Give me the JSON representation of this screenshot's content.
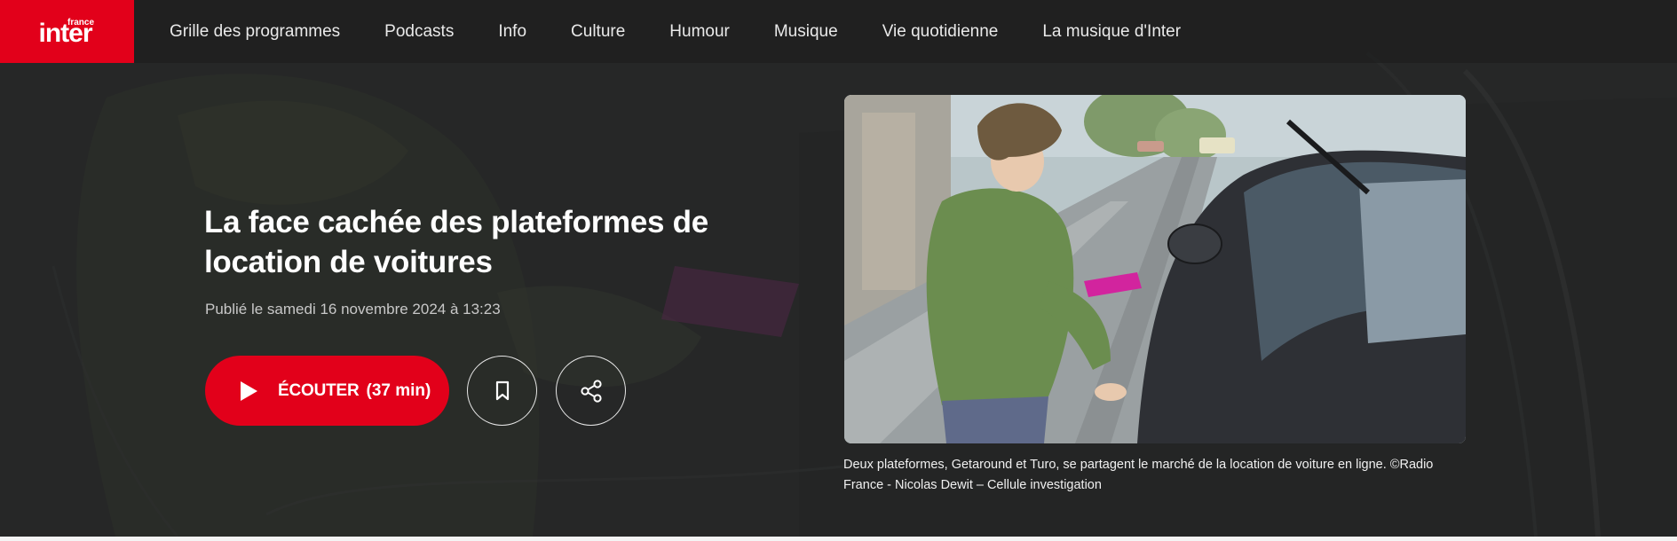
{
  "brand": {
    "logo_small": "france",
    "logo_main": "inter",
    "accent_color": "#e2001a"
  },
  "nav": {
    "items": [
      {
        "label": "Grille des programmes"
      },
      {
        "label": "Podcasts"
      },
      {
        "label": "Info"
      },
      {
        "label": "Culture"
      },
      {
        "label": "Humour"
      },
      {
        "label": "Musique"
      },
      {
        "label": "Vie quotidienne"
      },
      {
        "label": "La musique d'Inter"
      }
    ]
  },
  "article": {
    "title": "La face cachée des plateformes de location de voitures",
    "published": "Publié le samedi 16 novembre 2024 à 13:23",
    "listen_label": "ÉCOUTER",
    "listen_duration": "(37 min)",
    "icons": {
      "play": "play-icon",
      "bookmark": "bookmark-icon",
      "share": "share-icon"
    }
  },
  "image": {
    "caption": "Deux plateformes, Getaround et Turo, se partagent le marché de la location de voiture en ligne. ©Radio France - Nicolas Dewit – Cellule investigation"
  }
}
